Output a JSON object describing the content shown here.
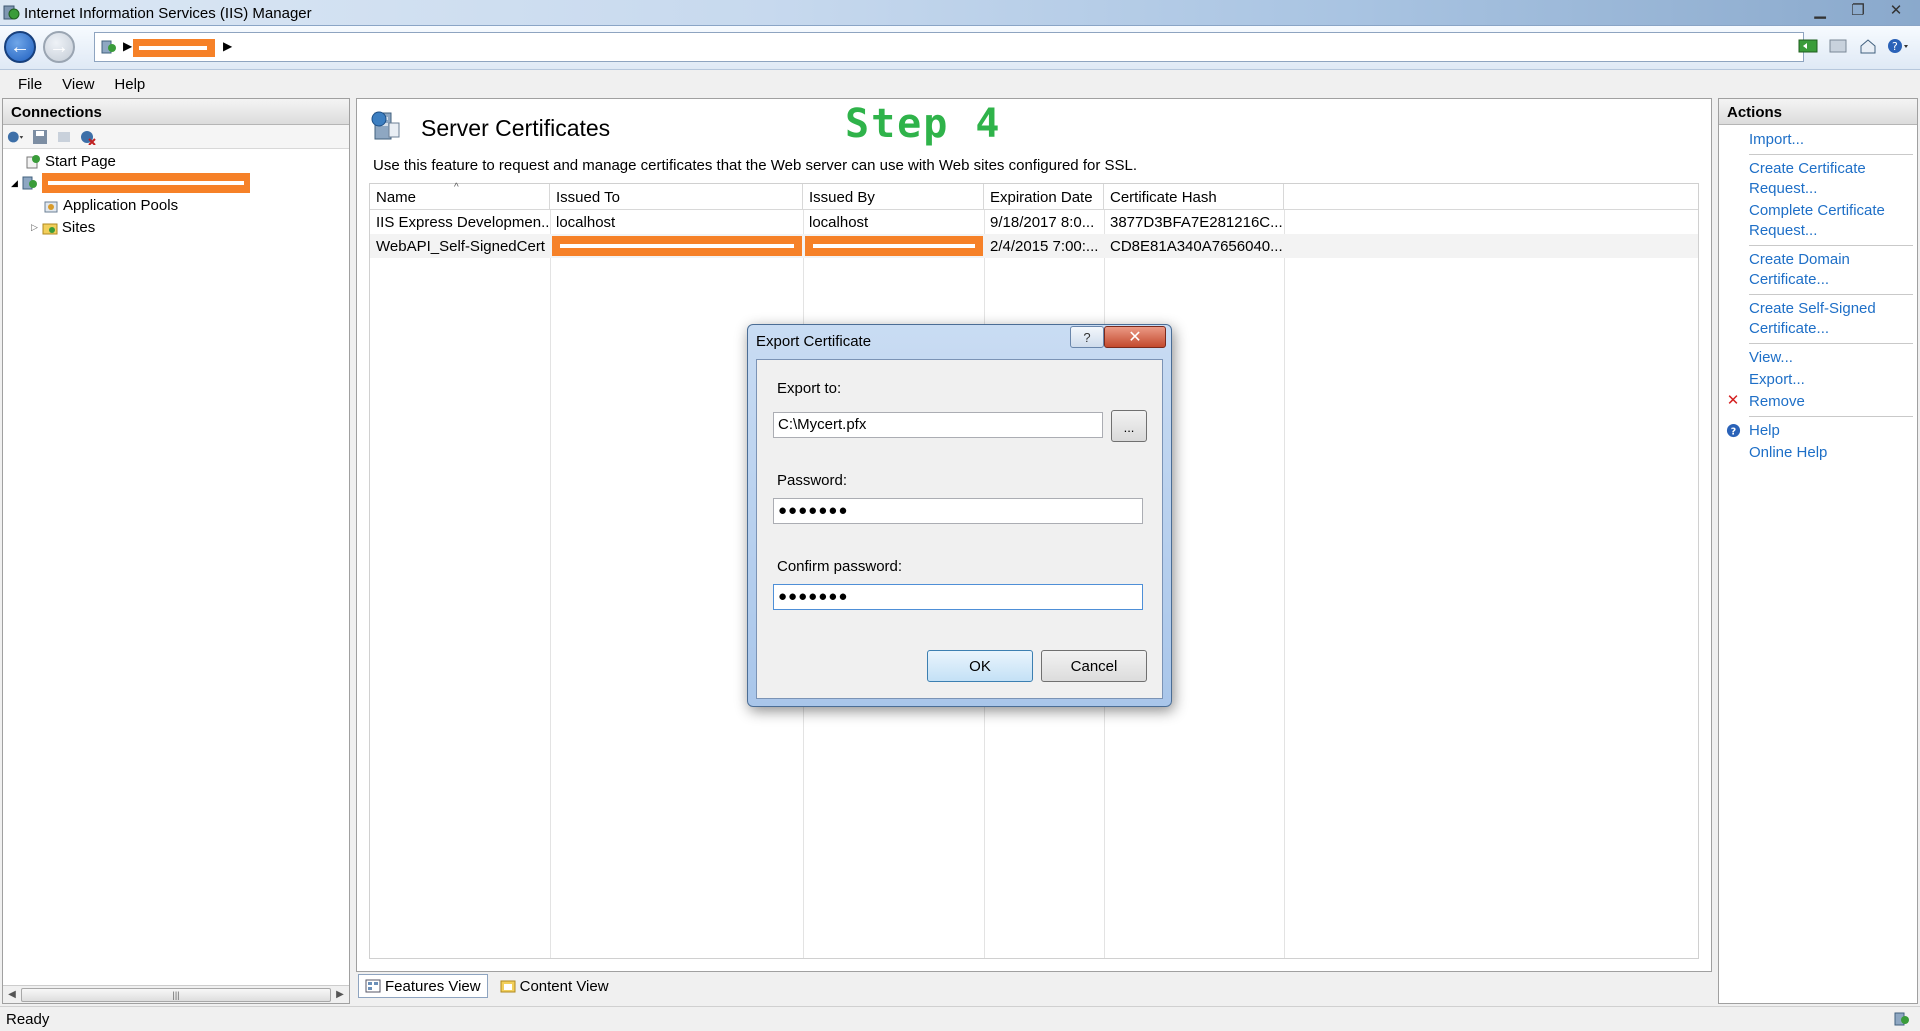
{
  "window": {
    "title": "Internet Information Services (IIS) Manager"
  },
  "menu": [
    "File",
    "View",
    "Help"
  ],
  "connections": {
    "title": "Connections",
    "tree": {
      "start_page": "Start Page",
      "app_pools": "Application Pools",
      "sites": "Sites"
    }
  },
  "main": {
    "title": "Server Certificates",
    "step": "Step 4",
    "description": "Use this feature to request and manage certificates that the Web server can use with Web sites configured for SSL.",
    "columns": [
      "Name",
      "Issued To",
      "Issued By",
      "Expiration Date",
      "Certificate Hash"
    ],
    "rows": [
      [
        "IIS Express Developmen...",
        "localhost",
        "localhost",
        "9/18/2017 8:0...",
        "3877D3BFA7E281216C..."
      ],
      [
        "WebAPI_Self-SignedCert",
        "",
        "",
        "2/4/2015 7:00:...",
        "CD8E81A340A7656040..."
      ]
    ],
    "tabs": {
      "features": "Features View",
      "content": "Content View"
    }
  },
  "actions": {
    "title": "Actions",
    "items": {
      "import": "Import...",
      "create_cert_request": "Create Certificate Request...",
      "complete_cert_request": "Complete Certificate Request...",
      "create_domain_cert": "Create Domain Certificate...",
      "create_self_signed": "Create Self-Signed Certificate...",
      "view": "View...",
      "export": "Export...",
      "remove": "Remove",
      "help": "Help",
      "online_help": "Online Help"
    }
  },
  "dialog": {
    "title": "Export Certificate",
    "help_label": "?",
    "close_label": "✕",
    "export_to_label": "Export to:",
    "export_to_value": "C:\\Mycert.pfx",
    "browse_label": "...",
    "password_label": "Password:",
    "password_value": "●●●●●●●",
    "confirm_label": "Confirm password:",
    "confirm_value": "●●●●●●●",
    "ok_label": "OK",
    "cancel_label": "Cancel"
  },
  "status": {
    "text": "Ready"
  },
  "colors": {
    "accent_link": "#1e6fc7",
    "step_green": "#2fb34a",
    "redaction_orange": "#f68128"
  }
}
